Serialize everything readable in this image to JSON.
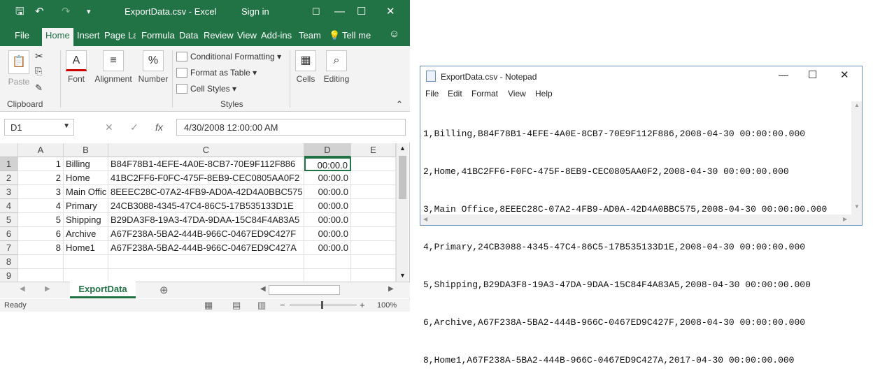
{
  "excel": {
    "title": "ExportData.csv  -  Excel",
    "signin": "Sign in",
    "tabs": [
      "File",
      "Home",
      "Insert",
      "Page Lay",
      "Formula",
      "Data",
      "Review",
      "View",
      "Add-ins",
      "Team",
      "Tell me"
    ],
    "ribbon": {
      "paste": "Paste",
      "clipboard": "Clipboard",
      "font": "Font",
      "alignment": "Alignment",
      "number": "Number",
      "conditional": "Conditional Formatting",
      "format_table": "Format as Table",
      "cell_styles": "Cell Styles",
      "styles": "Styles",
      "cells": "Cells",
      "editing": "Editing"
    },
    "namebox": "D1",
    "formula": "4/30/2008  12:00:00 AM",
    "columns": [
      "A",
      "B",
      "C",
      "D",
      "E"
    ],
    "rows": [
      {
        "n": "1",
        "a": "1",
        "b": "Billing",
        "c": "B84F78B1-4EFE-4A0E-8CB7-70E9F112F886",
        "d": "00:00.0"
      },
      {
        "n": "2",
        "a": "2",
        "b": "Home",
        "c": "41BC2FF6-F0FC-475F-8EB9-CEC0805AA0F2",
        "d": "00:00.0"
      },
      {
        "n": "3",
        "a": "3",
        "b": "Main Offic",
        "c": "8EEEC28C-07A2-4FB9-AD0A-42D4A0BBC575",
        "d": "00:00.0"
      },
      {
        "n": "4",
        "a": "4",
        "b": "Primary",
        "c": "24CB3088-4345-47C4-86C5-17B535133D1E",
        "d": "00:00.0"
      },
      {
        "n": "5",
        "a": "5",
        "b": "Shipping",
        "c": "B29DA3F8-19A3-47DA-9DAA-15C84F4A83A5",
        "d": "00:00.0"
      },
      {
        "n": "6",
        "a": "6",
        "b": "Archive",
        "c": "A67F238A-5BA2-444B-966C-0467ED9C427F",
        "d": "00:00.0"
      },
      {
        "n": "7",
        "a": "8",
        "b": "Home1",
        "c": "A67F238A-5BA2-444B-966C-0467ED9C427A",
        "d": "00:00.0"
      },
      {
        "n": "8",
        "a": "",
        "b": "",
        "c": "",
        "d": ""
      },
      {
        "n": "9",
        "a": "",
        "b": "",
        "c": "",
        "d": ""
      }
    ],
    "sheet_tab": "ExportData",
    "status": "Ready",
    "zoom": "100%"
  },
  "notepad": {
    "title": "ExportData.csv - Notepad",
    "menu": [
      "File",
      "Edit",
      "Format",
      "View",
      "Help"
    ],
    "lines": [
      "1,Billing,B84F78B1-4EFE-4A0E-8CB7-70E9F112F886,2008-04-30 00:00:00.000",
      "2,Home,41BC2FF6-F0FC-475F-8EB9-CEC0805AA0F2,2008-04-30 00:00:00.000",
      "3,Main Office,8EEEC28C-07A2-4FB9-AD0A-42D4A0BBC575,2008-04-30 00:00:00.000",
      "4,Primary,24CB3088-4345-47C4-86C5-17B535133D1E,2008-04-30 00:00:00.000",
      "5,Shipping,B29DA3F8-19A3-47DA-9DAA-15C84F4A83A5,2008-04-30 00:00:00.000",
      "6,Archive,A67F238A-5BA2-444B-966C-0467ED9C427F,2008-04-30 00:00:00.000",
      "8,Home1,A67F238A-5BA2-444B-966C-0467ED9C427A,2017-04-30 00:00:00.000"
    ]
  }
}
